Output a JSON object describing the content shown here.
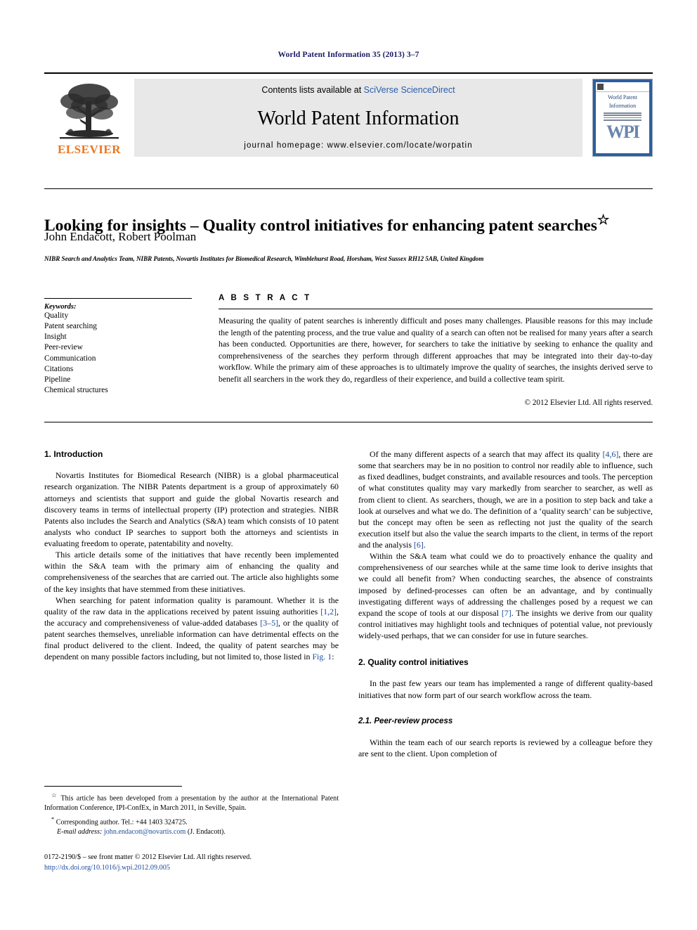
{
  "running_head": "World Patent Information 35 (2013) 3–7",
  "masthead": {
    "publisher_name": "ELSEVIER",
    "contents_prefix": "Contents lists available at ",
    "contents_link": "SciVerse ScienceDirect",
    "journal_title": "World Patent Information",
    "homepage_label": "journal homepage: www.elsevier.com/locate/worpatin",
    "cover": {
      "line1": "World Patent",
      "line2": "Information",
      "monogram": "WPI"
    }
  },
  "article": {
    "title": "Looking for insights – Quality control initiatives for enhancing patent searches",
    "title_marker": "☆",
    "authors": "John Endacott, Robert Poolman",
    "author_marker": "*",
    "affiliation": "NIBR Search and Analytics Team, NIBR Patents, Novartis Institutes for Biomedical Research, Wimblehurst Road, Horsham, West Sussex RH12 5AB, United Kingdom"
  },
  "keywords": {
    "heading": "Keywords:",
    "items": [
      "Quality",
      "Patent searching",
      "Insight",
      "Peer-review",
      "Communication",
      "Citations",
      "Pipeline",
      "Chemical structures"
    ]
  },
  "abstract": {
    "label": "A B S T R A C T",
    "body": "Measuring the quality of patent searches is inherently difficult and poses many challenges. Plausible reasons for this may include the length of the patenting process, and the true value and quality of a search can often not be realised for many years after a search has been conducted. Opportunities are there, however, for searchers to take the initiative by seeking to enhance the quality and comprehensiveness of the searches they perform through different approaches that may be integrated into their day-to-day workflow. While the primary aim of these approaches is to ultimately improve the quality of searches, the insights derived serve to benefit all searchers in the work they do, regardless of their experience, and build a collective team spirit.",
    "copyright": "© 2012 Elsevier Ltd. All rights reserved."
  },
  "body": {
    "left": {
      "section1_heading": "1. Introduction",
      "p1": "Novartis Institutes for Biomedical Research (NIBR) is a global pharmaceutical research organization. The NIBR Patents department is a group of approximately 60 attorneys and scientists that support and guide the global Novartis research and discovery teams in terms of intellectual property (IP) protection and strategies. NIBR Patents also includes the Search and Analytics (S&A) team which consists of 10 patent analysts who conduct IP searches to support both the attorneys and scientists in evaluating freedom to operate, patentability and novelty.",
      "p2": "This article details some of the initiatives that have recently been implemented within the S&A team with the primary aim of enhancing the quality and comprehensiveness of the searches that are carried out. The article also highlights some of the key insights that have stemmed from these initiatives.",
      "p3_a": "When searching for patent information quality is paramount. Whether it is the quality of the raw data in the applications received by patent issuing authorities ",
      "p3_ref1": "[1,2]",
      "p3_b": ", the accuracy and comprehensiveness of value-added databases ",
      "p3_ref2": "[3–5]",
      "p3_c": ", or the quality of patent searches themselves, unreliable information can have detrimental effects on the final product delivered to the client. Indeed, the quality of patent searches may be dependent on many possible factors including, but not limited to, those listed in ",
      "p3_ref3": "Fig. 1",
      "p3_d": ":"
    },
    "right": {
      "p1_a": "Of the many different aspects of a search that may affect its quality ",
      "p1_ref": "[4,6]",
      "p1_b": ", there are some that searchers may be in no position to control nor readily able to influence, such as fixed deadlines, budget constraints, and available resources and tools. The perception of what constitutes quality may vary markedly from searcher to searcher, as well as from client to client. As searchers, though, we are in a position to step back and take a look at ourselves and what we do. The definition of a ‘quality search’ can be subjective, but the concept may often be seen as reflecting not just the quality of the search execution itself but also the value the search imparts to the client, in terms of the report and the analysis ",
      "p1_ref2": "[6]",
      "p1_c": ".",
      "p2_a": "Within the S&A team what could we do to proactively enhance the quality and comprehensiveness of our searches while at the same time look to derive insights that we could all benefit from? When conducting searches, the absence of constraints imposed by defined-processes can often be an advantage, and by continually investigating different ways of addressing the challenges posed by a request we can expand the scope of tools at our disposal ",
      "p2_ref": "[7]",
      "p2_b": ". The insights we derive from our quality control initiatives may highlight tools and techniques of potential value, not previously widely-used perhaps, that we can consider for use in future searches.",
      "section2_heading": "2. Quality control initiatives",
      "p3": "In the past few years our team has implemented a range of different quality-based initiatives that now form part of our search workflow across the team.",
      "subsection21_heading": "2.1. Peer-review process",
      "p4": "Within the team each of our search reports is reviewed by a colleague before they are sent to the client. Upon completion of"
    }
  },
  "footnotes": {
    "star_marker": "☆",
    "star_text": "This article has been developed from a presentation by the author at the International Patent Information Conference, IPI-ConfEx, in March 2011, in Seville, Spain.",
    "corresponding_marker": "*",
    "corresponding_text": "Corresponding author. Tel.: +44 1403 324725.",
    "email_label": "E-mail address:",
    "email_address": "john.endacott@novartis.com",
    "email_suffix": "(J. Endacott)."
  },
  "imprint": {
    "line1": "0172-2190/$ – see front matter © 2012 Elsevier Ltd. All rights reserved.",
    "doi": "http://dx.doi.org/10.1016/j.wpi.2012.09.005"
  },
  "colors": {
    "running_head": "#1b1b64",
    "elsevier_orange": "#E87722",
    "link_blue": "#2a5caa",
    "reference_blue": "#1b4a9c",
    "band_gray": "#e8e8e8",
    "cover_blue": "#2c5f9e"
  }
}
